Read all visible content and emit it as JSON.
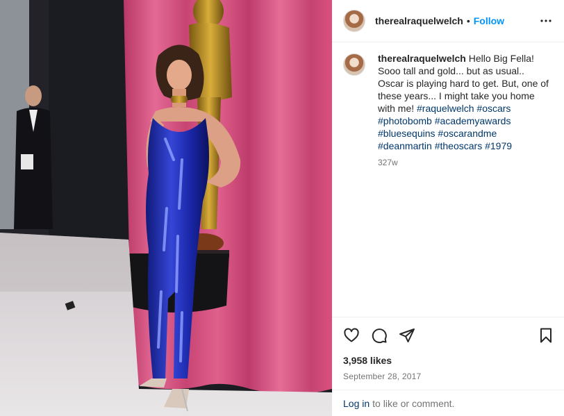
{
  "post": {
    "username": "therealraquelwelch",
    "separator": "•",
    "follow_label": "Follow",
    "more_icon": "more-options-icon",
    "caption": {
      "username": "therealraquelwelch",
      "text": "Hello Big Fella! Sooo tall and gold... but as usual.. Oscar is playing hard to get. But, one of these years... I might take you home with me!",
      "hashtags": [
        "#raquelwelch",
        "#oscars",
        "#photobomb",
        "#academyawards",
        "#bluesequins",
        "#oscarandme",
        "#deanmartin",
        "#theoscars",
        "#1979"
      ],
      "age": "327w"
    },
    "actions": {
      "like_icon": "heart-icon",
      "comment_icon": "comment-icon",
      "share_icon": "share-icon",
      "save_icon": "bookmark-icon"
    },
    "likes": "3,958 likes",
    "date": "September 28, 2017",
    "login_link": "Log in",
    "login_text": "to like or comment."
  },
  "colors": {
    "link_blue": "#0095f6",
    "hashtag": "#00376b",
    "secondary_text": "#737373",
    "curtain": "#d9517e",
    "sequins": "#1e2fb8"
  }
}
